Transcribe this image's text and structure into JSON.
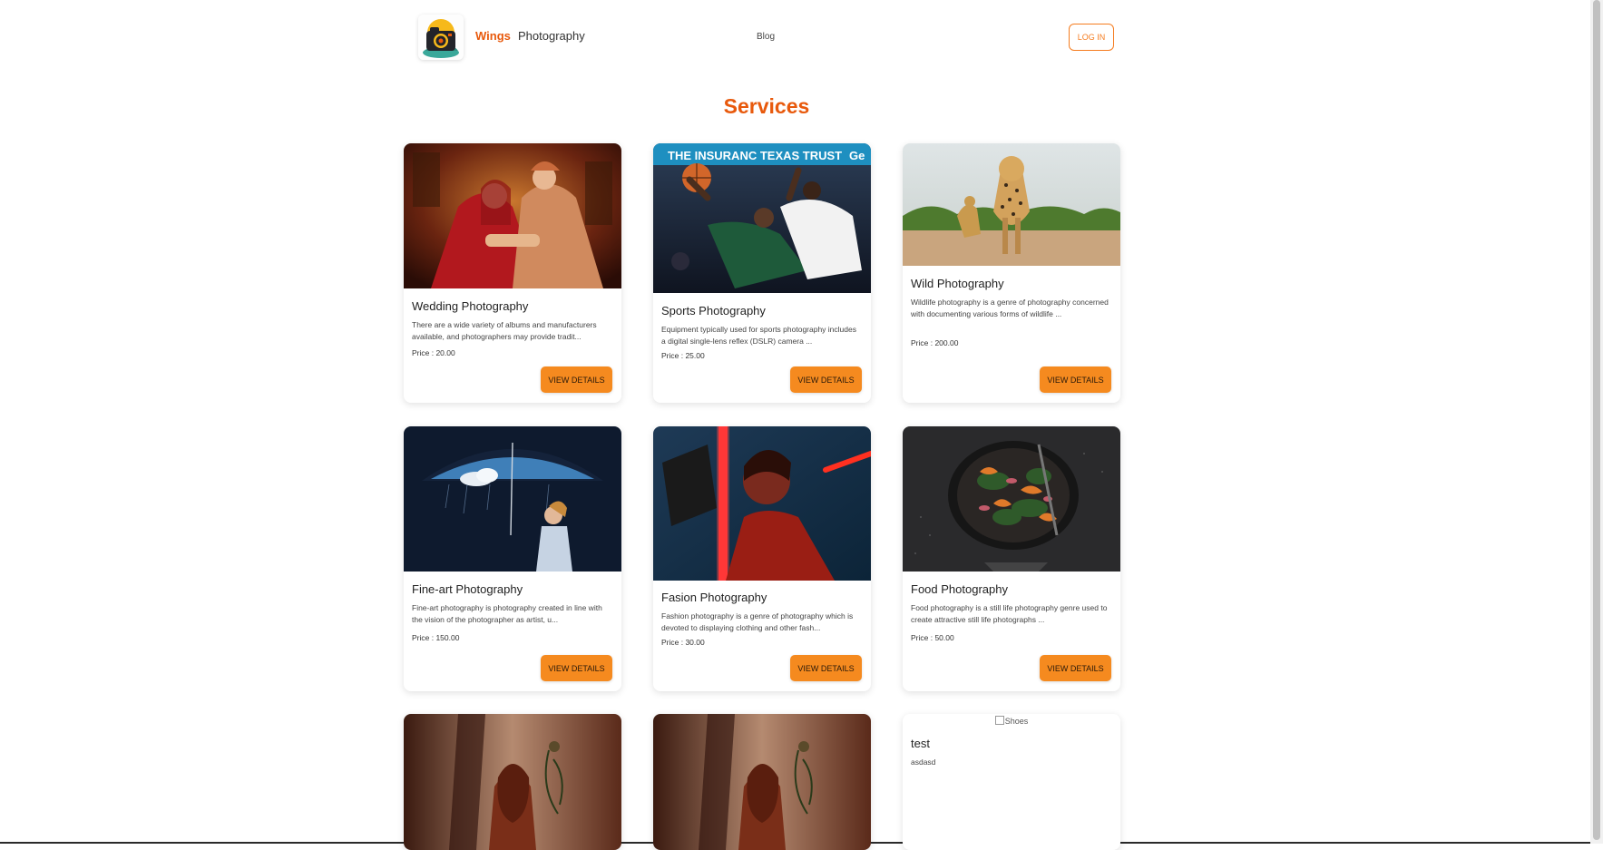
{
  "nav": {
    "brand_wings": "Wings",
    "brand_photography": "Photography",
    "blog_label": "Blog",
    "login_label": "LOG IN"
  },
  "page": {
    "title": "Services"
  },
  "colors": {
    "accent": "#e8590c",
    "button": "#f58a1f"
  },
  "services": [
    {
      "title": "Wedding Photography",
      "description": "There are a wide variety of albums and manufacturers available, and photographers may provide tradit...",
      "price": "Price : 20.00",
      "button": "VIEW DETAILS",
      "image": "wedding-couple-photo"
    },
    {
      "title": "Sports Photography",
      "description": "Equipment typically used for sports photography includes a digital single-lens reflex (DSLR) camera ...",
      "price": "Price : 25.00",
      "button": "VIEW DETAILS",
      "image": "basketball-players-photo",
      "banner_left": "THE INSURANC   TEXAS TRUST",
      "banner_right": "Ge"
    },
    {
      "title": "Wild Photography",
      "description": "Wildlife photography is a genre of photography concerned with documenting various forms of wildlife ...",
      "price": "Price : 200.00",
      "button": "VIEW DETAILS",
      "image": "leopards-photo"
    },
    {
      "title": "Fine-art Photography",
      "description": "Fine-art photography is photography created in line with the vision of the photographer as artist, u...",
      "price": "Price : 150.00",
      "button": "VIEW DETAILS",
      "image": "girl-umbrella-photo"
    },
    {
      "title": "Fasion Photography",
      "description": "Fashion photography is a genre of photography which is devoted to displaying clothing and other fash...",
      "price": "Price : 30.00",
      "button": "VIEW DETAILS",
      "image": "fashion-red-light-photo"
    },
    {
      "title": "Food Photography",
      "description": "Food photography is a still life photography genre used to create attractive still life photographs ...",
      "price": "Price : 50.00",
      "button": "VIEW DETAILS",
      "image": "food-pan-photo"
    },
    {
      "image": "woman-portrait-photo"
    },
    {
      "image": "woman-portrait-photo"
    },
    {
      "image_alt": "Shoes",
      "title": "test",
      "description": "asdasd"
    }
  ]
}
